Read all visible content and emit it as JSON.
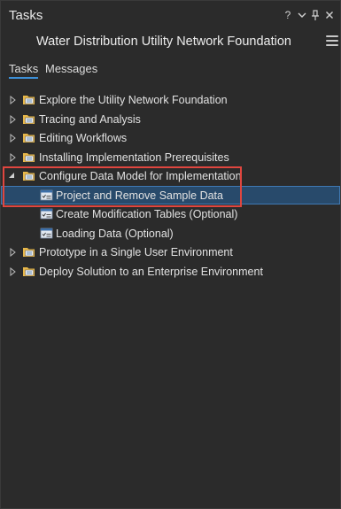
{
  "window": {
    "title": "Tasks",
    "help_glyph": "?",
    "dropdown_glyph": "⌄",
    "pin_glyph": "⊥",
    "close_glyph": "×"
  },
  "header": {
    "subtitle": "Water Distribution Utility Network Foundation"
  },
  "tabs": [
    {
      "label": "Tasks",
      "active": true
    },
    {
      "label": "Messages",
      "active": false
    }
  ],
  "tree": {
    "items": [
      {
        "label": "Explore the Utility Network Foundation",
        "type": "group",
        "expanded": false
      },
      {
        "label": "Tracing and Analysis",
        "type": "group",
        "expanded": false
      },
      {
        "label": "Editing Workflows",
        "type": "group",
        "expanded": false
      },
      {
        "label": "Installing Implementation Prerequisites",
        "type": "group",
        "expanded": false
      },
      {
        "label": "Configure Data Model for Implementation",
        "type": "group",
        "expanded": true
      },
      {
        "label": "Project and Remove Sample Data",
        "type": "task",
        "selected": true
      },
      {
        "label": "Create Modification Tables (Optional)",
        "type": "task",
        "selected": false
      },
      {
        "label": "Loading Data (Optional)",
        "type": "task",
        "selected": false
      },
      {
        "label": "Prototype in a Single User Environment",
        "type": "group",
        "expanded": false
      },
      {
        "label": "Deploy Solution to an Enterprise Environment",
        "type": "group",
        "expanded": false
      }
    ]
  },
  "colors": {
    "background": "#2b2b2b",
    "selection": "#284a6b",
    "highlight_box": "#e0463f",
    "folder": "#e8b84a",
    "tab_underline": "#3d8fd6"
  }
}
